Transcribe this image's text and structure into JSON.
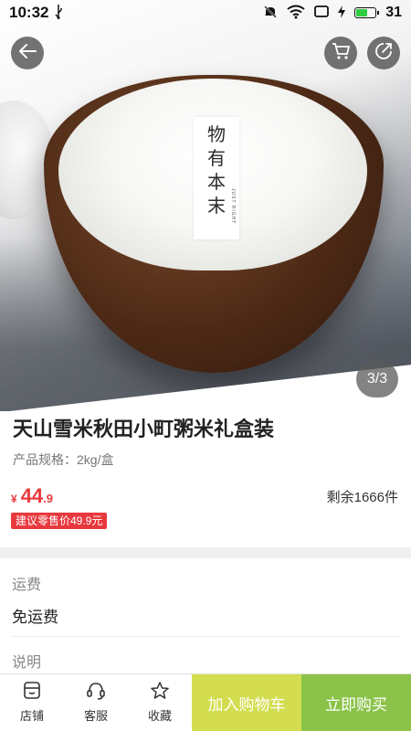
{
  "status_bar": {
    "time": "10:32",
    "usb_icon": "usb-icon",
    "battery_level": "31",
    "accent": "#2ecc40"
  },
  "hero": {
    "page_indicator": "3/3",
    "brand_chars": [
      "物",
      "有",
      "本",
      "末"
    ],
    "brand_sub": "JUST RIGHT"
  },
  "product": {
    "title": "天山雪米秋田小町粥米礼盒装",
    "spec": "产品规格：2kg/盒",
    "price_symbol": "¥",
    "price_int": "44",
    "price_dec": ".9",
    "stock": "剩余1666件",
    "msrp": "建议零售价49.9元",
    "price_color": "#e8383d"
  },
  "shipping": {
    "label": "运费",
    "value": "免运费"
  },
  "description": {
    "label": "说明"
  },
  "bottom_bar": {
    "store": "店铺",
    "service": "客服",
    "favorite": "收藏",
    "add_to_cart": "加入购物车",
    "buy_now": "立即购买",
    "add_to_cart_color": "#d3dd4f",
    "buy_now_color": "#8bc34a"
  }
}
